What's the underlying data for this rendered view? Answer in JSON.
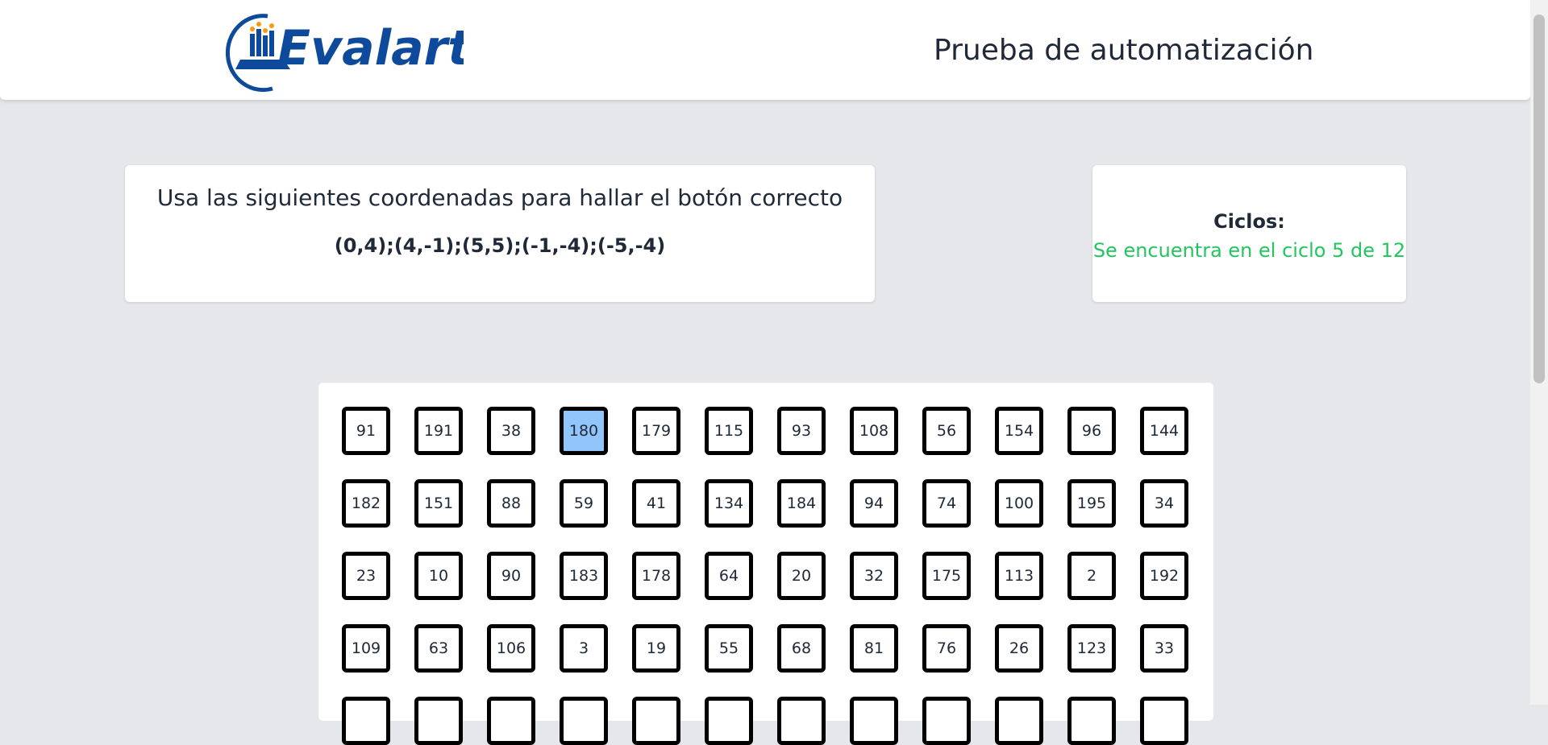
{
  "header": {
    "logo_text": "Evalart",
    "title": "Prueba de automatización"
  },
  "instructions": {
    "text": "Usa las siguientes coordenadas para hallar el botón correcto",
    "coordinates": "(0,4);(4,-1);(5,5);(-1,-4);(-5,-4)"
  },
  "cycles": {
    "label": "Ciclos:",
    "status": "Se encuentra en el ciclo 5 de 12"
  },
  "grid": {
    "selected_value": "180",
    "rows": [
      [
        "91",
        "191",
        "38",
        "180",
        "179",
        "115",
        "93",
        "108",
        "56",
        "154",
        "96",
        "144"
      ],
      [
        "182",
        "151",
        "88",
        "59",
        "41",
        "134",
        "184",
        "94",
        "74",
        "100",
        "195",
        "34"
      ],
      [
        "23",
        "10",
        "90",
        "183",
        "178",
        "64",
        "20",
        "32",
        "175",
        "113",
        "2",
        "192"
      ],
      [
        "109",
        "63",
        "106",
        "3",
        "19",
        "55",
        "68",
        "81",
        "76",
        "26",
        "123",
        "33"
      ],
      [
        "",
        "",
        "",
        "",
        "",
        "",
        "",
        "",
        "",
        "",
        "",
        ""
      ]
    ]
  },
  "colors": {
    "page_background": "#e5e7eb",
    "status_green": "#22c55e",
    "selected_button": "#93c5fd",
    "logo_blue": "#0d4a9c",
    "logo_orange": "#f39c12"
  }
}
